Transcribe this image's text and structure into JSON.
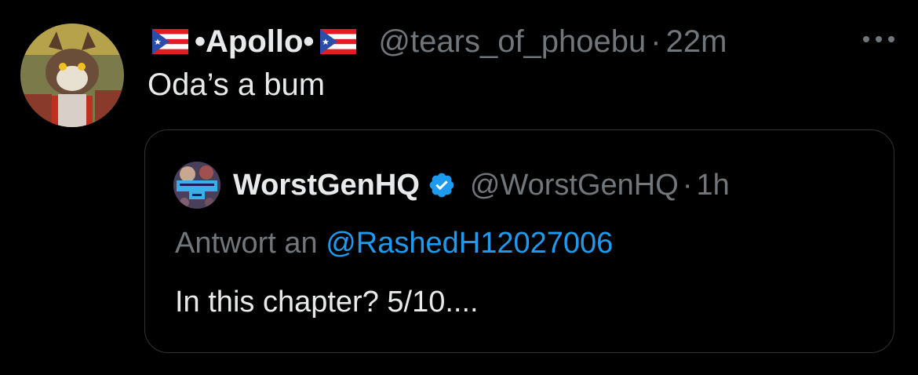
{
  "tweet": {
    "author": {
      "display_name": "•Apollo•",
      "flag_icon": "puerto-rico-flag-icon",
      "handle": "@tears_of_phoebu",
      "separator": "·",
      "time": "22m",
      "avatar_icon": "cartoon-character-avatar"
    },
    "text": "Oda’s a bum",
    "more_icon": "more-horizontal-icon"
  },
  "quote": {
    "author": {
      "display_name": "WorstGenHQ",
      "verified_icon": "verified-badge-icon",
      "verified_color": "#1d9bf0",
      "handle": "@WorstGenHQ",
      "separator": "·",
      "time": "1h",
      "avatar_icon": "worstgen-logo-avatar"
    },
    "reply_prefix": "Antwort an",
    "reply_mention": "@RashedH12027006",
    "text": "In this chapter? 5/10...."
  },
  "colors": {
    "background": "#000000",
    "primary_text": "#e7e9ea",
    "secondary_text": "#71767b",
    "link": "#1d9bf0",
    "border": "#2f3336"
  }
}
